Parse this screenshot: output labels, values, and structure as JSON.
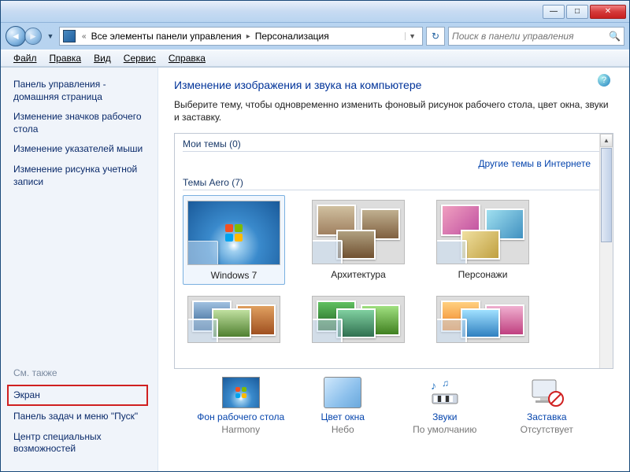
{
  "titlebar": {
    "min": "—",
    "max": "□",
    "close": "✕"
  },
  "address": {
    "back": "◄",
    "forward": "►",
    "dropdown": "▼",
    "crumb1": "Все элементы панели управления",
    "crumb2": "Персонализация",
    "chev": "«",
    "sep": "▸",
    "addr_drop": "▼",
    "refresh": "↻"
  },
  "search": {
    "placeholder": "Поиск в панели управления",
    "icon": "🔍"
  },
  "menu": {
    "file": "Файл",
    "edit": "Правка",
    "view": "Вид",
    "tools": "Сервис",
    "help": "Справка"
  },
  "sidebar": {
    "home": "Панель управления - домашняя страница",
    "items": [
      "Изменение значков рабочего стола",
      "Изменение указателей мыши",
      "Изменение рисунка учетной записи"
    ],
    "see_also": "См. также",
    "also_items": [
      "Экран",
      "Панель задач и меню \"Пуск\"",
      "Центр специальных возможностей"
    ]
  },
  "main": {
    "help": "?",
    "title": "Изменение изображения и звука на компьютере",
    "desc": "Выберите тему, чтобы одновременно изменить фоновый рисунок рабочего стола, цвет окна, звуки и заставку.",
    "my_themes": "Мои темы (0)",
    "internet_link": "Другие темы в Интернете",
    "aero_themes": "Темы Aero (7)",
    "themes": [
      "Windows 7",
      "Архитектура",
      "Персонажи"
    ],
    "scroll_up": "▲",
    "scroll_down": "▾"
  },
  "bottom": {
    "bg": {
      "title": "Фон рабочего стола",
      "sub": "Harmony"
    },
    "color": {
      "title": "Цвет окна",
      "sub": "Небо"
    },
    "sound": {
      "title": "Звуки",
      "sub": "По умолчанию"
    },
    "saver": {
      "title": "Заставка",
      "sub": "Отсутствует"
    }
  }
}
